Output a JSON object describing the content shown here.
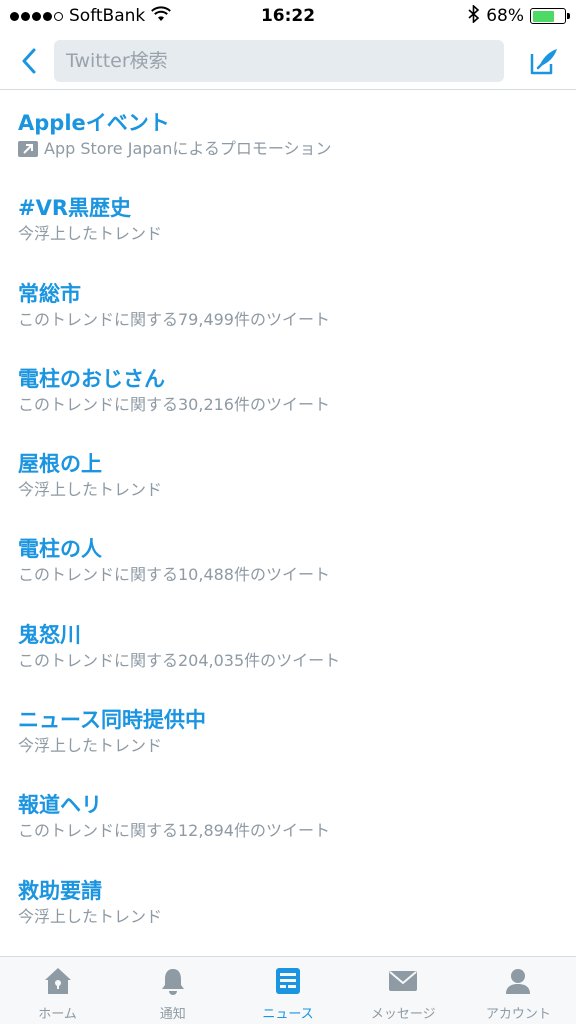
{
  "status_bar": {
    "carrier": "SoftBank",
    "time": "16:22",
    "battery_percent": "68%",
    "battery_level": 0.68,
    "signal_bars_filled": 4,
    "signal_bars_total": 5
  },
  "nav": {
    "search_placeholder": "Twitter検索"
  },
  "trends": [
    {
      "title": "Appleイベント",
      "subtitle": "App Store Japanによるプロモーション",
      "promoted": true
    },
    {
      "title": "#VR黒歴史",
      "subtitle": "今浮上したトレンド",
      "promoted": false
    },
    {
      "title": "常総市",
      "subtitle": "このトレンドに関する79,499件のツイート",
      "promoted": false
    },
    {
      "title": "電柱のおじさん",
      "subtitle": "このトレンドに関する30,216件のツイート",
      "promoted": false
    },
    {
      "title": "屋根の上",
      "subtitle": "今浮上したトレンド",
      "promoted": false
    },
    {
      "title": "電柱の人",
      "subtitle": "このトレンドに関する10,488件のツイート",
      "promoted": false
    },
    {
      "title": "鬼怒川",
      "subtitle": "このトレンドに関する204,035件のツイート",
      "promoted": false
    },
    {
      "title": "ニュース同時提供中",
      "subtitle": "今浮上したトレンド",
      "promoted": false
    },
    {
      "title": "報道ヘリ",
      "subtitle": "このトレンドに関する12,894件のツイート",
      "promoted": false
    },
    {
      "title": "救助要請",
      "subtitle": "今浮上したトレンド",
      "promoted": false
    }
  ],
  "tab_bar": {
    "items": [
      {
        "label": "ホーム",
        "icon": "home-icon",
        "active": false
      },
      {
        "label": "通知",
        "icon": "bell-icon",
        "active": false
      },
      {
        "label": "ニュース",
        "icon": "news-icon",
        "active": true
      },
      {
        "label": "メッセージ",
        "icon": "envelope-icon",
        "active": false
      },
      {
        "label": "アカウント",
        "icon": "person-icon",
        "active": false
      }
    ]
  },
  "colors": {
    "accent": "#1b95e0",
    "subtext": "#8e9aa4",
    "battery_fill": "#4cd964"
  }
}
